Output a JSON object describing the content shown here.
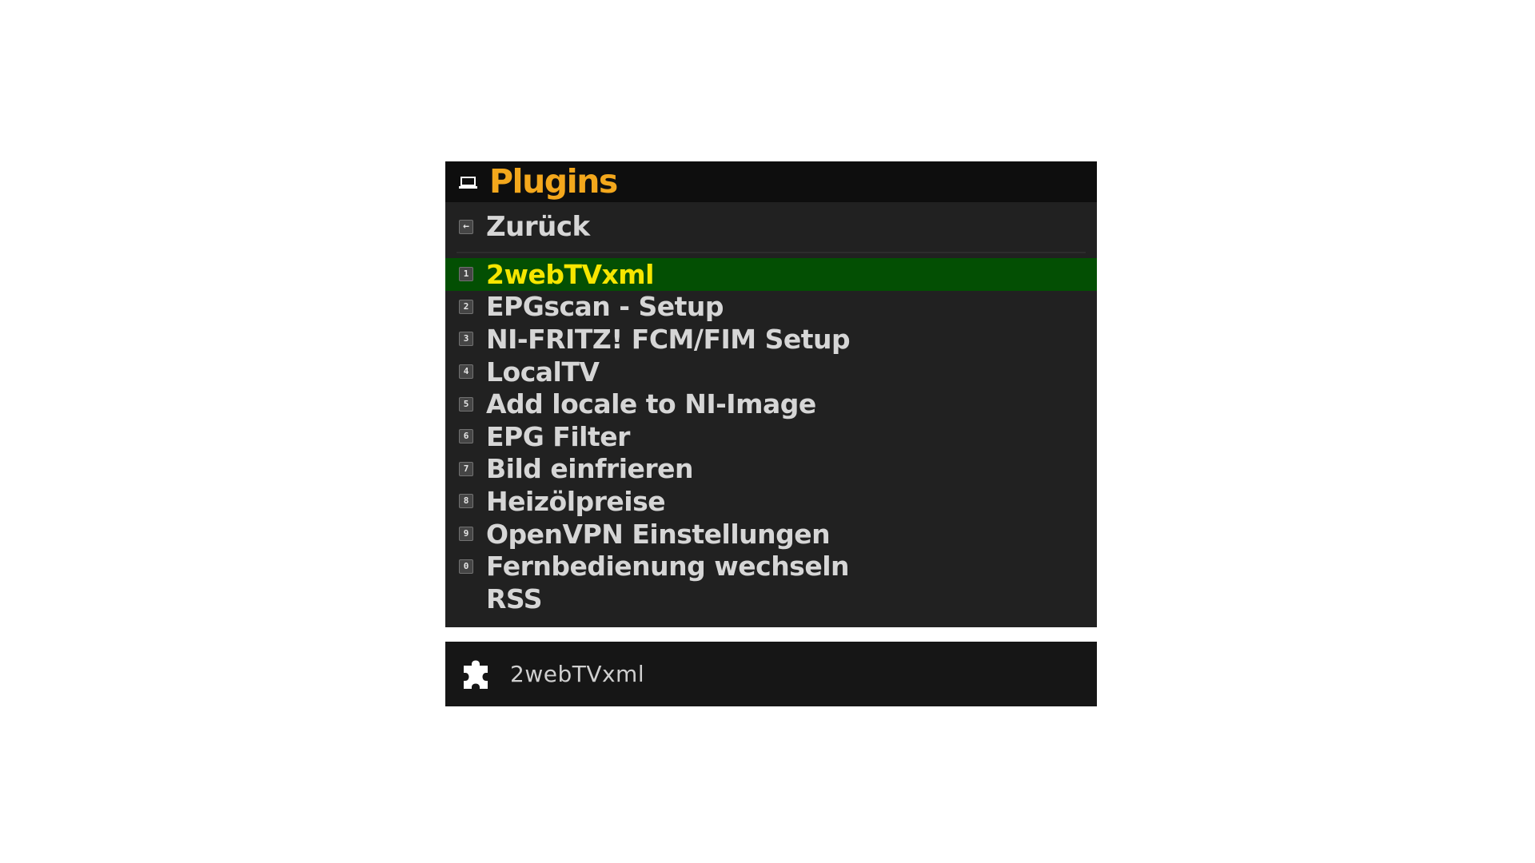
{
  "menu": {
    "title": "Plugins",
    "back": {
      "key": "←",
      "label": "Zurück"
    },
    "selected_index": 0,
    "items": [
      {
        "key": "1",
        "label": "2webTVxml"
      },
      {
        "key": "2",
        "label": "EPGscan - Setup"
      },
      {
        "key": "3",
        "label": "NI-FRITZ! FCM/FIM Setup"
      },
      {
        "key": "4",
        "label": "LocalTV"
      },
      {
        "key": "5",
        "label": "Add locale to NI-Image"
      },
      {
        "key": "6",
        "label": "EPG Filter"
      },
      {
        "key": "7",
        "label": "Bild einfrieren"
      },
      {
        "key": "8",
        "label": "Heizölpreise"
      },
      {
        "key": "9",
        "label": "OpenVPN Einstellungen"
      },
      {
        "key": "0",
        "label": "Fernbedienung wechseln"
      },
      {
        "key": "",
        "label": "RSS"
      }
    ]
  },
  "info": {
    "text": "2webTVxml"
  },
  "colors": {
    "title": "#f3a71c",
    "selected_bg": "#034f03",
    "selected_text": "#f6e600",
    "item_text": "#d6d6d6"
  }
}
